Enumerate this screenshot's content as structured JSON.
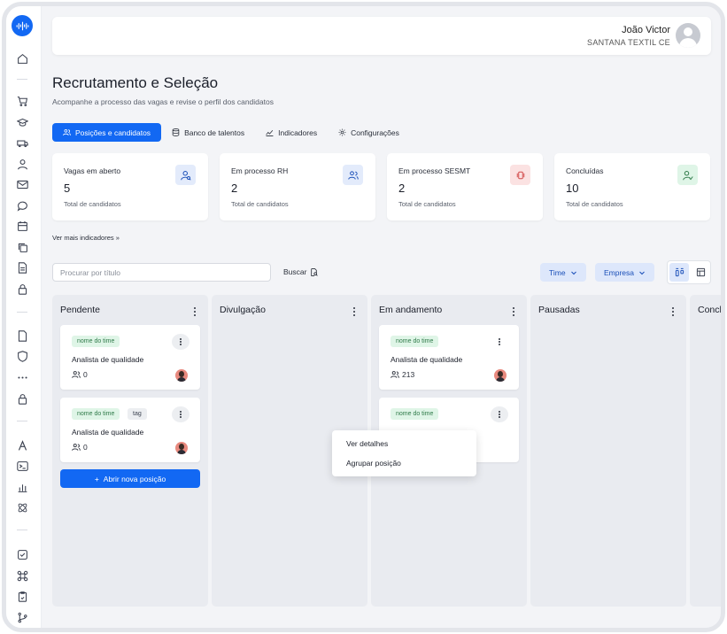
{
  "user": {
    "name": "João Victor",
    "company": "SANTANA TEXTIL CE"
  },
  "page": {
    "title": "Recrutamento e Seleção",
    "subtitle": "Acompanhe a processo das vagas e revise o perfil dos candidatos"
  },
  "tabs": [
    {
      "label": "Posições e candidatos",
      "icon": "users-icon",
      "active": true
    },
    {
      "label": "Banco de talentos",
      "icon": "database-icon",
      "active": false
    },
    {
      "label": "Indicadores",
      "icon": "trend-icon",
      "active": false
    },
    {
      "label": "Configurações",
      "icon": "gear-icon",
      "active": false
    }
  ],
  "stats": [
    {
      "label": "Vagas em aberto",
      "value": "5",
      "sub": "Total de candidatos",
      "icon": "user-search-icon",
      "color": "#e3ebfb"
    },
    {
      "label": "Em processo RH",
      "value": "2",
      "sub": "Total de candidatos",
      "icon": "users-icon",
      "color": "#e3ebfb"
    },
    {
      "label": "Em processo SESMT",
      "value": "2",
      "sub": "Total de candidatos",
      "icon": "cards-icon",
      "color": "#fbe2e2"
    },
    {
      "label": "Concluídas",
      "value": "10",
      "sub": "Total de candidatos",
      "icon": "user-check-icon",
      "color": "#dff5e7"
    }
  ],
  "more_indicators": "Ver mais indicadores",
  "search": {
    "placeholder": "Procurar por título",
    "button": "Buscar"
  },
  "filters": {
    "time": "Time",
    "company": "Empresa"
  },
  "columns": [
    {
      "title": "Pendente"
    },
    {
      "title": "Divulgação"
    },
    {
      "title": "Em andamento"
    },
    {
      "title": "Pausadas"
    },
    {
      "title": "Concl"
    }
  ],
  "cards": {
    "pending": [
      {
        "team": "nome do time",
        "tag": "",
        "title": "Analista de qualidade",
        "count": "0"
      },
      {
        "team": "nome do time",
        "tag": "tag",
        "title": "Analista de qualidade",
        "count": "0"
      }
    ],
    "progress": [
      {
        "team": "nome do time",
        "title": "Analista de qualidade",
        "count": "213"
      },
      {
        "team": "nome do time"
      }
    ]
  },
  "add_position": "Abrir nova posição",
  "context_menu": {
    "details": "Ver detalhes",
    "group": "Agrupar posição"
  }
}
